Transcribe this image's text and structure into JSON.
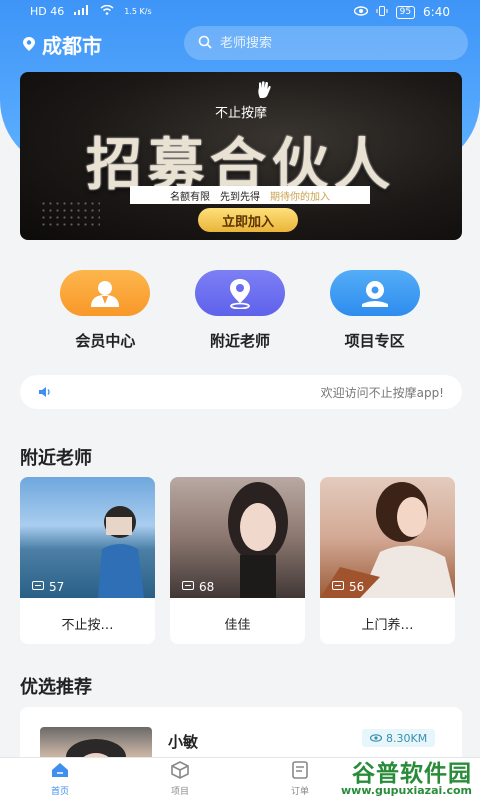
{
  "status_bar": {
    "net_left": "HD 46",
    "speed": "1.5 K/s",
    "battery": "95",
    "time": "6:40"
  },
  "header": {
    "city": "成都市",
    "search_placeholder": "老师搜索"
  },
  "banner": {
    "brand": "不止按摩",
    "headline": "招募合伙人",
    "sub_parts": [
      "名额有限",
      "先到先得",
      "期待你的加入"
    ],
    "cta": "立即加入"
  },
  "quick_actions": [
    {
      "label": "会员中心",
      "icon": "member-icon",
      "color": "#f9a23a"
    },
    {
      "label": "附近老师",
      "icon": "location-icon",
      "color": "#6a6ef0"
    },
    {
      "label": "项目专区",
      "icon": "project-icon",
      "color": "#3c9bf2"
    }
  ],
  "notice": {
    "text": "欢迎访问不止按摩app!"
  },
  "nearby": {
    "title": "附近老师",
    "items": [
      {
        "name": "不止按…",
        "views": "57"
      },
      {
        "name": "佳佳",
        "views": "68"
      },
      {
        "name": "上门养…",
        "views": "56"
      }
    ]
  },
  "recommend": {
    "title": "优选推荐",
    "items": [
      {
        "name": "小敏",
        "distance": "8.30KM"
      }
    ]
  },
  "tabbar": {
    "tabs": [
      "首页",
      "项目",
      "订单",
      ""
    ]
  },
  "watermark": {
    "title": "谷普软件园",
    "url": "www.gupuxiazai.com"
  }
}
